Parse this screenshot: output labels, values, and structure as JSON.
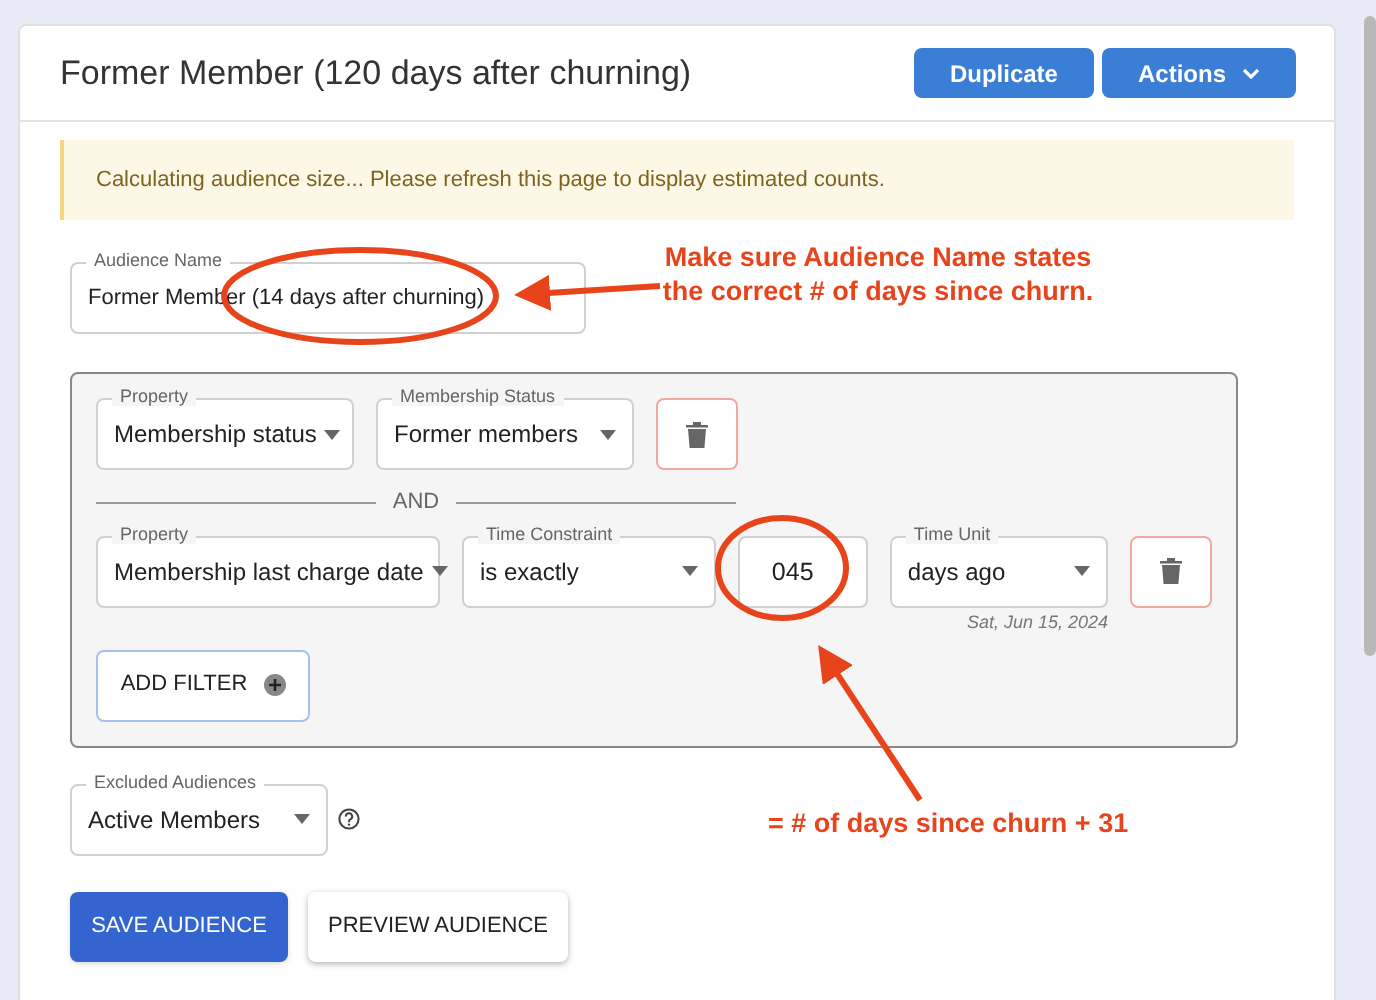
{
  "page": {
    "title": "Former Member (120 days after churning)",
    "buttons": [
      {
        "label": "Duplicate",
        "kind": "plain"
      },
      {
        "label": "Actions",
        "kind": "menu"
      }
    ]
  },
  "alert": "Calculating audience size... Please refresh this page to display estimated counts.",
  "audience_name": {
    "label": "Audience Name",
    "value": "Former Member (14 days after churning)"
  },
  "filters": [
    {
      "fields": [
        {
          "kind": "select",
          "label": "Property",
          "value": "Membership status"
        },
        {
          "kind": "select",
          "label": "Membership Status",
          "value": "Former members"
        }
      ]
    },
    {
      "fields": [
        {
          "kind": "select",
          "label": "Property",
          "value": "Membership last charge date"
        },
        {
          "kind": "select",
          "label": "Time Constraint",
          "value": "is exactly"
        },
        {
          "kind": "input",
          "value": "045"
        },
        {
          "kind": "select",
          "label": "Time Unit",
          "value": "days ago",
          "hint": "Sat, Jun 15, 2024"
        }
      ]
    }
  ],
  "joiner": "AND",
  "add_filter": "ADD FILTER",
  "excluded": {
    "label": "Excluded Audiences",
    "value": "Active Members"
  },
  "actions": [
    {
      "label": "SAVE AUDIENCE",
      "kind": "primary"
    },
    {
      "label": "PREVIEW AUDIENCE",
      "kind": "secondary"
    }
  ],
  "annotations": [
    "Make sure Audience Name states\nthe correct # of days since churn.",
    "= # of days since churn + 31"
  ]
}
